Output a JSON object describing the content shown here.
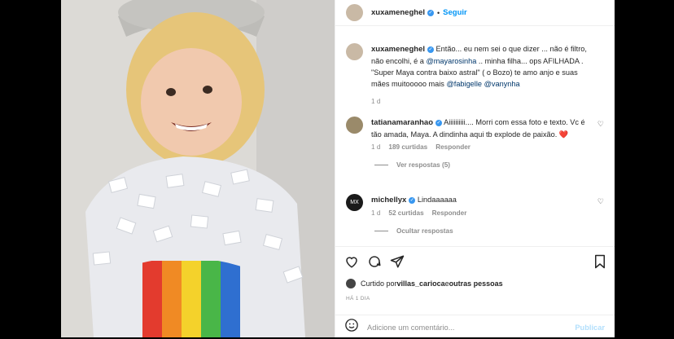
{
  "header": {
    "username": "xuxameneghel",
    "separator": "•",
    "follow_label": "Seguir"
  },
  "caption": {
    "username": "xuxameneghel",
    "text_1": " Então... eu nem sei o que dizer ... não é filtro, não encolhi, é a ",
    "mention_1": "@mayarosinha",
    "text_2": " .. minha filha... ops AFILHADA . \"Super Maya contra baixo astral\" ( o Bozo) te amo anjo e suas mães muitooooo mais ",
    "mention_2": "@fabigelle",
    "text_3": " ",
    "mention_3": "@vanynha",
    "time": "1 d"
  },
  "comments": [
    {
      "username": "tatianamaranhao",
      "text": " Aiiiiiiiiii.... Morri com essa foto e texto. Vc é tão amada, Maya. A dindinha aqui tb explode de paixão. ❤️",
      "time": "1 d",
      "likes": "189 curtidas",
      "reply": "Responder",
      "replies_toggle": "Ver respostas (5)"
    },
    {
      "username": "michellyx",
      "text": " Lindaaaaaa",
      "time": "1 d",
      "likes": "52 curtidas",
      "reply": "Responder",
      "replies_toggle": "Ocultar respostas"
    }
  ],
  "likes_line": {
    "prefix": "Curtido por ",
    "user": "villas_carioca",
    "suffix": " e ",
    "others": "outras pessoas"
  },
  "post_time": "HÁ 1 DIA",
  "add_comment": {
    "placeholder": "Adicione um comentário...",
    "publish_label": "Publicar"
  },
  "icons": {
    "like": "heart-icon",
    "comment": "comment-icon",
    "share": "send-icon",
    "save": "bookmark-icon",
    "emoji": "smiley-icon"
  },
  "colors": {
    "link": "#0095f6",
    "mention": "#00376b",
    "verified": "#3897f0",
    "heart_red": "#ed4956",
    "muted": "#8e8e8e"
  }
}
